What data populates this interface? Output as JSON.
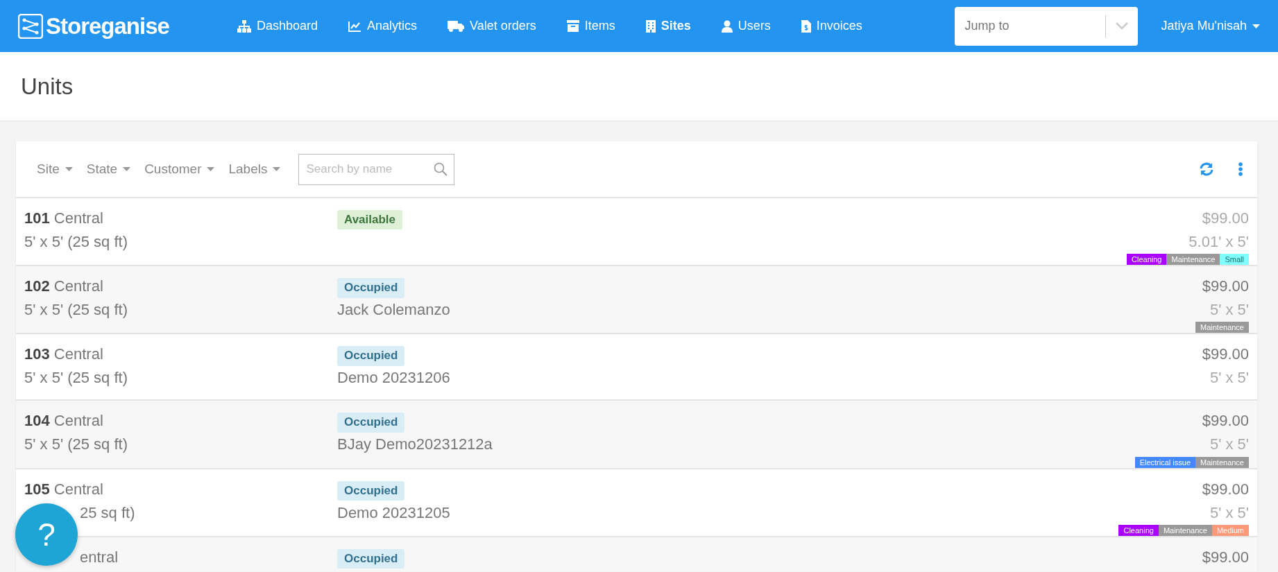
{
  "brand": "Storeganise",
  "nav": [
    {
      "label": "Dashboard",
      "selected": false
    },
    {
      "label": "Analytics",
      "selected": false
    },
    {
      "label": "Valet orders",
      "selected": false
    },
    {
      "label": "Items",
      "selected": false
    },
    {
      "label": "Sites",
      "selected": true
    },
    {
      "label": "Users",
      "selected": false
    },
    {
      "label": "Invoices",
      "selected": false
    }
  ],
  "jump_to": {
    "placeholder": "Jump to"
  },
  "user": {
    "name": "Jatiya Mu'nisah"
  },
  "page_title": "Units",
  "filters": [
    "Site",
    "State",
    "Customer",
    "Labels"
  ],
  "search": {
    "placeholder": "Search by name"
  },
  "units": [
    {
      "number": "101",
      "site": "Central",
      "size": "5' x 5' (25 sq ft)",
      "state": {
        "text": "Available",
        "kind": "available"
      },
      "price": "$99.00",
      "dimensions": "5.01' x 5'",
      "labels": [
        {
          "text": "Cleaning",
          "color": "#aa00ff"
        },
        {
          "text": "Maintenance",
          "color": "#999999"
        },
        {
          "text": "Small",
          "color": "#80ffff"
        }
      ]
    },
    {
      "number": "102",
      "site": "Central",
      "size": "5' x 5' (25 sq ft)",
      "state": {
        "text": "Occupied",
        "kind": "occupied"
      },
      "customer": "Jack Colemanzo",
      "price": "$99.00",
      "dimensions": "5' x 5'",
      "labels": [
        {
          "text": "Maintenance",
          "color": "#999999"
        }
      ]
    },
    {
      "number": "103",
      "site": "Central",
      "size": "5' x 5' (25 sq ft)",
      "state": {
        "text": "Occupied",
        "kind": "occupied"
      },
      "customer": "Demo 20231206",
      "price": "$99.00",
      "dimensions": "5' x 5'"
    },
    {
      "number": "104",
      "site": "Central",
      "size": "5' x 5' (25 sq ft)",
      "state": {
        "text": "Occupied",
        "kind": "occupied"
      },
      "customer": "BJay Demo20231212a",
      "price": "$99.00",
      "dimensions": "5' x 5'",
      "labels": [
        {
          "text": "Electrical issue",
          "color": "#4488ff"
        },
        {
          "text": "Maintenance",
          "color": "#999999"
        }
      ]
    },
    {
      "number": "105",
      "site": "Central",
      "size": "25 sq ft)",
      "size_partly_hidden": true,
      "state": {
        "text": "Occupied",
        "kind": "occupied"
      },
      "customer": "Demo 20231205",
      "price": "$99.00",
      "dimensions": "5' x 5'",
      "labels": [
        {
          "text": "Cleaning",
          "color": "#aa00ff"
        },
        {
          "text": "Maintenance",
          "color": "#999999"
        },
        {
          "text": "Medium",
          "color": "#ff9977"
        }
      ]
    },
    {
      "site": "entral",
      "site_partly_hidden": true,
      "state": {
        "text": "Occupied",
        "kind": "occupied"
      },
      "price": "$99.00"
    }
  ],
  "help": {
    "label": "?"
  }
}
